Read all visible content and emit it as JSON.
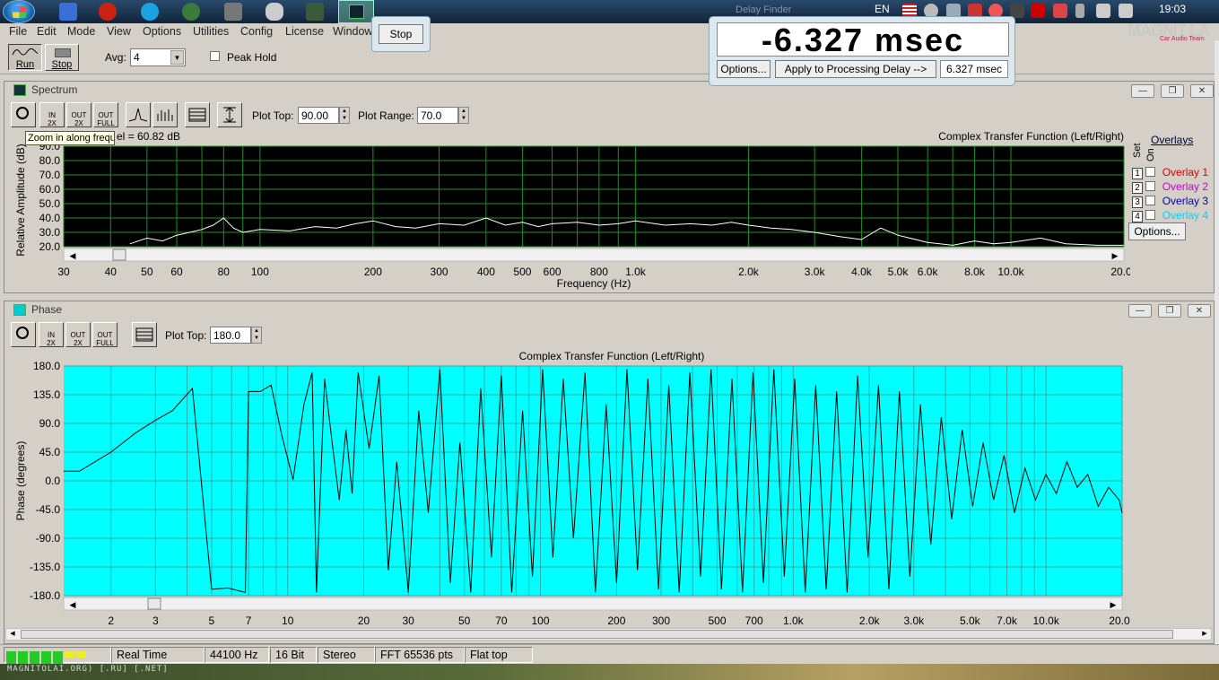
{
  "taskbar": {
    "language": "EN",
    "clock": "19:03",
    "ghost_title": "Delay Finder"
  },
  "menu": [
    "File",
    "Edit",
    "Mode",
    "View",
    "Options",
    "Utilities",
    "Config",
    "License",
    "Window"
  ],
  "watermark": {
    "text": "MAGNIT LA",
    "sub": "Car Audio Team"
  },
  "runbar": {
    "run_label": "Run",
    "stop_label": "Stop",
    "avg_label": "Avg:",
    "avg_value": "4",
    "peak_hold_label": "Peak Hold"
  },
  "stop_popup": {
    "label": "Stop"
  },
  "delay": {
    "readout": "-6.327 msec",
    "options_label": "Options...",
    "apply_label": "Apply to Processing Delay -->",
    "value": "6.327 msec"
  },
  "spectrum": {
    "title": "Spectrum",
    "plot_top_label": "Plot Top:",
    "plot_top_value": "90.00",
    "plot_range_label": "Plot Range:",
    "plot_range_value": "70.0",
    "tooltip": "Zoom in along frequency",
    "level_text": "el = 60.82 dB",
    "chart_title": "Complex Transfer Function (Left/Right)",
    "set_label": "Set",
    "on_label": "On",
    "overlays_label": "Overlays",
    "overlays": [
      {
        "num": "1",
        "name": "Overlay 1",
        "color": "#e00000"
      },
      {
        "num": "2",
        "name": "Overlay 2",
        "color": "#d000d0"
      },
      {
        "num": "3",
        "name": "Overlay 3",
        "color": "#0000c0"
      },
      {
        "num": "4",
        "name": "Overlay 4",
        "color": "#00d0ff"
      }
    ],
    "options_label": "Options..."
  },
  "phase": {
    "title": "Phase",
    "plot_top_label": "Plot Top:",
    "plot_top_value": "180.0"
  },
  "status": {
    "mode": "Real Time",
    "rate": "44100 Hz",
    "bits": "16 Bit",
    "channels": "Stereo",
    "fft": "FFT 65536 pts",
    "window": "Flat top"
  },
  "desktop_text": "MAGNITOLAI.ORG) [.RU] [.NET]",
  "chart_data": [
    {
      "type": "line",
      "title": "Complex Transfer Function (Left/Right)",
      "xlabel": "Frequency (Hz)",
      "ylabel": "Relative Amplitude (dB)",
      "x_scale": "log",
      "xlim": [
        30,
        20000
      ],
      "ylim": [
        20,
        90
      ],
      "yticks": [
        "90.0",
        "80.0",
        "70.0",
        "60.0",
        "50.0",
        "40.0",
        "30.0",
        "20.0"
      ],
      "xticks": [
        "30",
        "40",
        "50",
        "60",
        "80",
        "100",
        "200",
        "300",
        "400",
        "500",
        "600",
        "800",
        "1.0k",
        "2.0k",
        "3.0k",
        "4.0k",
        "5.0k",
        "6.0k",
        "8.0k",
        "10.0k",
        "20.0k"
      ],
      "background": "#000000",
      "grid_color": "#1f8f1f",
      "line_color": "#ffffff",
      "series": [
        {
          "x": [
            45,
            50,
            55,
            60,
            65,
            70,
            75,
            80,
            85,
            90,
            100,
            120,
            140,
            160,
            180,
            200,
            230,
            260,
            300,
            350,
            400,
            450,
            500,
            550,
            600,
            700,
            800,
            900,
            1000,
            1200,
            1400,
            1600,
            1800,
            2000,
            2300,
            2600,
            3000,
            3500,
            4000,
            4500,
            5000,
            6000,
            7000,
            8000,
            9000,
            10000,
            12000,
            14000,
            17000,
            20000
          ],
          "values": [
            22,
            26,
            24,
            28,
            30,
            32,
            35,
            40,
            33,
            30,
            32,
            31,
            34,
            33,
            36,
            38,
            34,
            33,
            36,
            35,
            40,
            35,
            37,
            34,
            36,
            37,
            35,
            36,
            38,
            35,
            36,
            35,
            37,
            35,
            33,
            32,
            30,
            27,
            25,
            33,
            28,
            23,
            21,
            24,
            22,
            23,
            26,
            22,
            21,
            21
          ]
        }
      ]
    },
    {
      "type": "line",
      "title": "Complex Transfer Function (Left/Right)",
      "xlabel": "",
      "ylabel": "Phase (degrees)",
      "x_scale": "log",
      "xlim": [
        1.3,
        20000
      ],
      "ylim": [
        -180,
        180
      ],
      "yticks": [
        "180.0",
        "135.0",
        "90.0",
        "45.0",
        "0.0",
        "-45.0",
        "-90.0",
        "-135.0",
        "-180.0"
      ],
      "xticks": [
        "2",
        "3",
        "5",
        "7",
        "10",
        "20",
        "30",
        "50",
        "70",
        "100",
        "200",
        "300",
        "500",
        "700",
        "1.0k",
        "2.0k",
        "3.0k",
        "5.0k",
        "7.0k",
        "10.0k",
        "20.0k"
      ],
      "background": "#00ffff",
      "grid_color": "#33aaaa",
      "line_color": "#000000",
      "series": [
        {
          "x": [
            1.3,
            1.5,
            2,
            2.5,
            3,
            3.5,
            4.2,
            5,
            5.8,
            6.8,
            7,
            7.8,
            8.6,
            9.5,
            10.5,
            11.6,
            12.5,
            13,
            14,
            15,
            16,
            17,
            18,
            19,
            21,
            23,
            25,
            27,
            30,
            33,
            36,
            40,
            44,
            48,
            53,
            58,
            64,
            70,
            77,
            85,
            93,
            102,
            112,
            123,
            135,
            150,
            165,
            182,
            200,
            220,
            242,
            266,
            293,
            322,
            354,
            390,
            430,
            473,
            520,
            572,
            630,
            693,
            762,
            838,
            922,
            1014,
            1115,
            1227,
            1350,
            1485,
            1633,
            1797,
            1976,
            2174,
            2391,
            2630,
            2893,
            3183,
            3501,
            3851,
            4236,
            4660,
            5126,
            5639,
            6202,
            6823,
            7505,
            8256,
            9081,
            9990,
            10989,
            12088,
            13296,
            14626,
            16088,
            17697,
            19467,
            20000
          ],
          "values": [
            15,
            15,
            45,
            75,
            95,
            110,
            145,
            -170,
            -168,
            -175,
            140,
            140,
            150,
            70,
            2,
            120,
            170,
            -175,
            160,
            60,
            -30,
            80,
            -20,
            170,
            50,
            165,
            -140,
            30,
            -175,
            110,
            -50,
            175,
            -160,
            60,
            -175,
            145,
            -120,
            165,
            -175,
            110,
            -150,
            175,
            -120,
            160,
            -90,
            170,
            -175,
            120,
            -160,
            175,
            -140,
            160,
            -170,
            150,
            -175,
            170,
            -150,
            175,
            -170,
            160,
            -175,
            170,
            -160,
            175,
            -150,
            160,
            -175,
            150,
            -170,
            140,
            -175,
            165,
            -120,
            150,
            -170,
            140,
            -150,
            120,
            -100,
            100,
            -60,
            80,
            -40,
            60,
            -30,
            40,
            -50,
            20,
            -30,
            10,
            -20,
            30,
            -10,
            10,
            -40,
            -10,
            -30,
            -50
          ]
        }
      ]
    }
  ]
}
